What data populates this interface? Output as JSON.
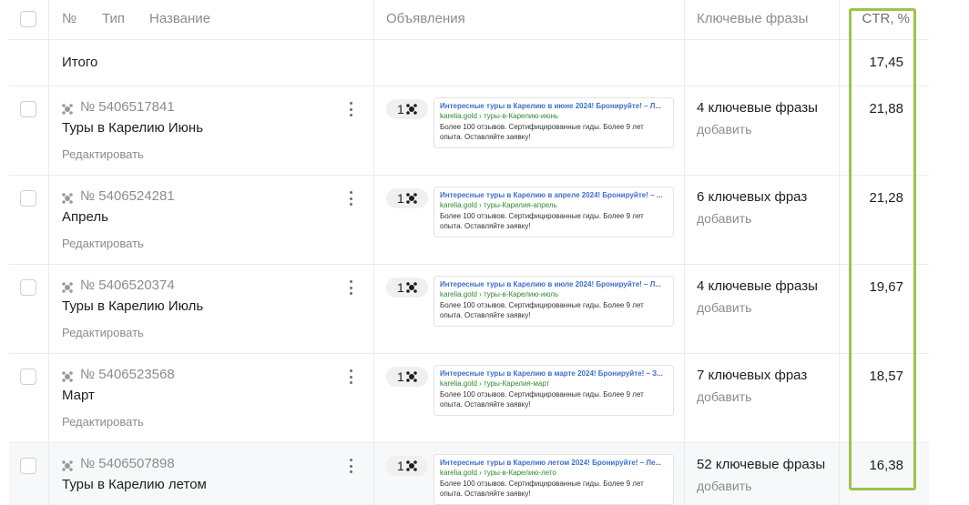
{
  "columns": {
    "num": "№",
    "type": "Тип",
    "name": "Название",
    "ads": "Объявления",
    "keywords": "Ключевые фразы",
    "ctr": "CTR, %"
  },
  "total": {
    "label": "Итого",
    "ctr": "17,45"
  },
  "rows": [
    {
      "num": "№ 5406517841",
      "title": "Туры в Карелию Июнь",
      "edit": "Редактировать",
      "ads_count": "1",
      "ad": {
        "title": "Интересные туры в Карелию в июне 2024! Бронируйте! – Л...",
        "url": "karelia.gold › туры-в-Карелию-июнь",
        "text": "Более 100 отзывов. Сертифицированные гиды. Более 9 лет опыта. Оставляйте заявку!"
      },
      "kw": "4 ключевые фразы",
      "kw_add": "добавить",
      "ctr": "21,88"
    },
    {
      "num": "№ 5406524281",
      "title": "Апрель",
      "edit": "Редактировать",
      "ads_count": "1",
      "ad": {
        "title": "Интересные туры в Карелию в апреле 2024! Бронируйте! – ...",
        "url": "karelia.gold › туры-Карелия-апрель",
        "text": "Более 100 отзывов. Сертифицированные гиды. Более 9 лет опыта. Оставляйте заявку!"
      },
      "kw": "6 ключевых фраз",
      "kw_add": "добавить",
      "ctr": "21,28"
    },
    {
      "num": "№ 5406520374",
      "title": "Туры в Карелию Июль",
      "edit": "Редактировать",
      "ads_count": "1",
      "ad": {
        "title": "Интересные туры в Карелию в июле 2024! Бронируйте! – Л...",
        "url": "karelia.gold › туры-в-Карелию-июль",
        "text": "Более 100 отзывов. Сертифицированные гиды. Более 9 лет опыта. Оставляйте заявку!"
      },
      "kw": "4 ключевые фразы",
      "kw_add": "добавить",
      "ctr": "19,67"
    },
    {
      "num": "№ 5406523568",
      "title": "Март",
      "edit": "Редактировать",
      "ads_count": "1",
      "ad": {
        "title": "Интересные туры в Карелию в марте 2024! Бронируйте! – З...",
        "url": "karelia.gold › туры-Карелия-март",
        "text": "Более 100 отзывов. Сертифицированные гиды. Более 9 лет опыта. Оставляйте заявку!"
      },
      "kw": "7 ключевых фраз",
      "kw_add": "добавить",
      "ctr": "18,57"
    },
    {
      "num": "№ 5406507898",
      "title": "Туры в Карелию летом",
      "edit": "Редактировать",
      "ads_count": "1",
      "ad": {
        "title": "Интересные туры в Карелию летом 2024! Бронируйте! – Ле...",
        "url": "karelia.gold › туры-в-Карелию-лето",
        "text": "Более 100 отзывов. Сертифицированные гиды. Более 9 лет опыта. Оставляйте заявку!"
      },
      "kw": "52 ключевые фразы",
      "kw_add": "добавить",
      "ctr": "16,38"
    }
  ],
  "colors": {
    "highlight_frame": "#9cc44a",
    "ad_title": "#3a6fd1",
    "ad_url": "#2f8a2f"
  }
}
